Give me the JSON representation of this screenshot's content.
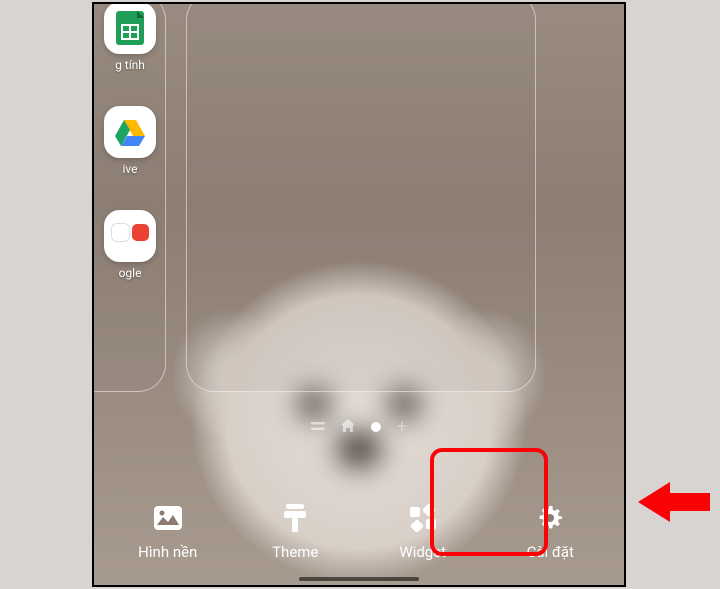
{
  "apps": {
    "sheets": {
      "label": "g tính",
      "name": "google-sheets-icon",
      "bg": "#ffffff",
      "accent": "#1e9e57"
    },
    "drive": {
      "label": "ive",
      "name": "google-drive-icon",
      "bg": "#ffffff"
    },
    "folder": {
      "label": "ogle",
      "name": "google-folder-icon",
      "bg": "#ffffff"
    }
  },
  "page_indicator": {
    "items": [
      "drawer-toggle",
      "home-icon",
      "dot-active",
      "add-page"
    ]
  },
  "toolbar": {
    "wallpaper": {
      "label": "Hình nền"
    },
    "theme": {
      "label": "Theme"
    },
    "widget": {
      "label": "Widget"
    },
    "settings": {
      "label": "Cài đặt"
    }
  },
  "annotations": {
    "highlight": "settings",
    "arrow_color": "#fb0207"
  }
}
